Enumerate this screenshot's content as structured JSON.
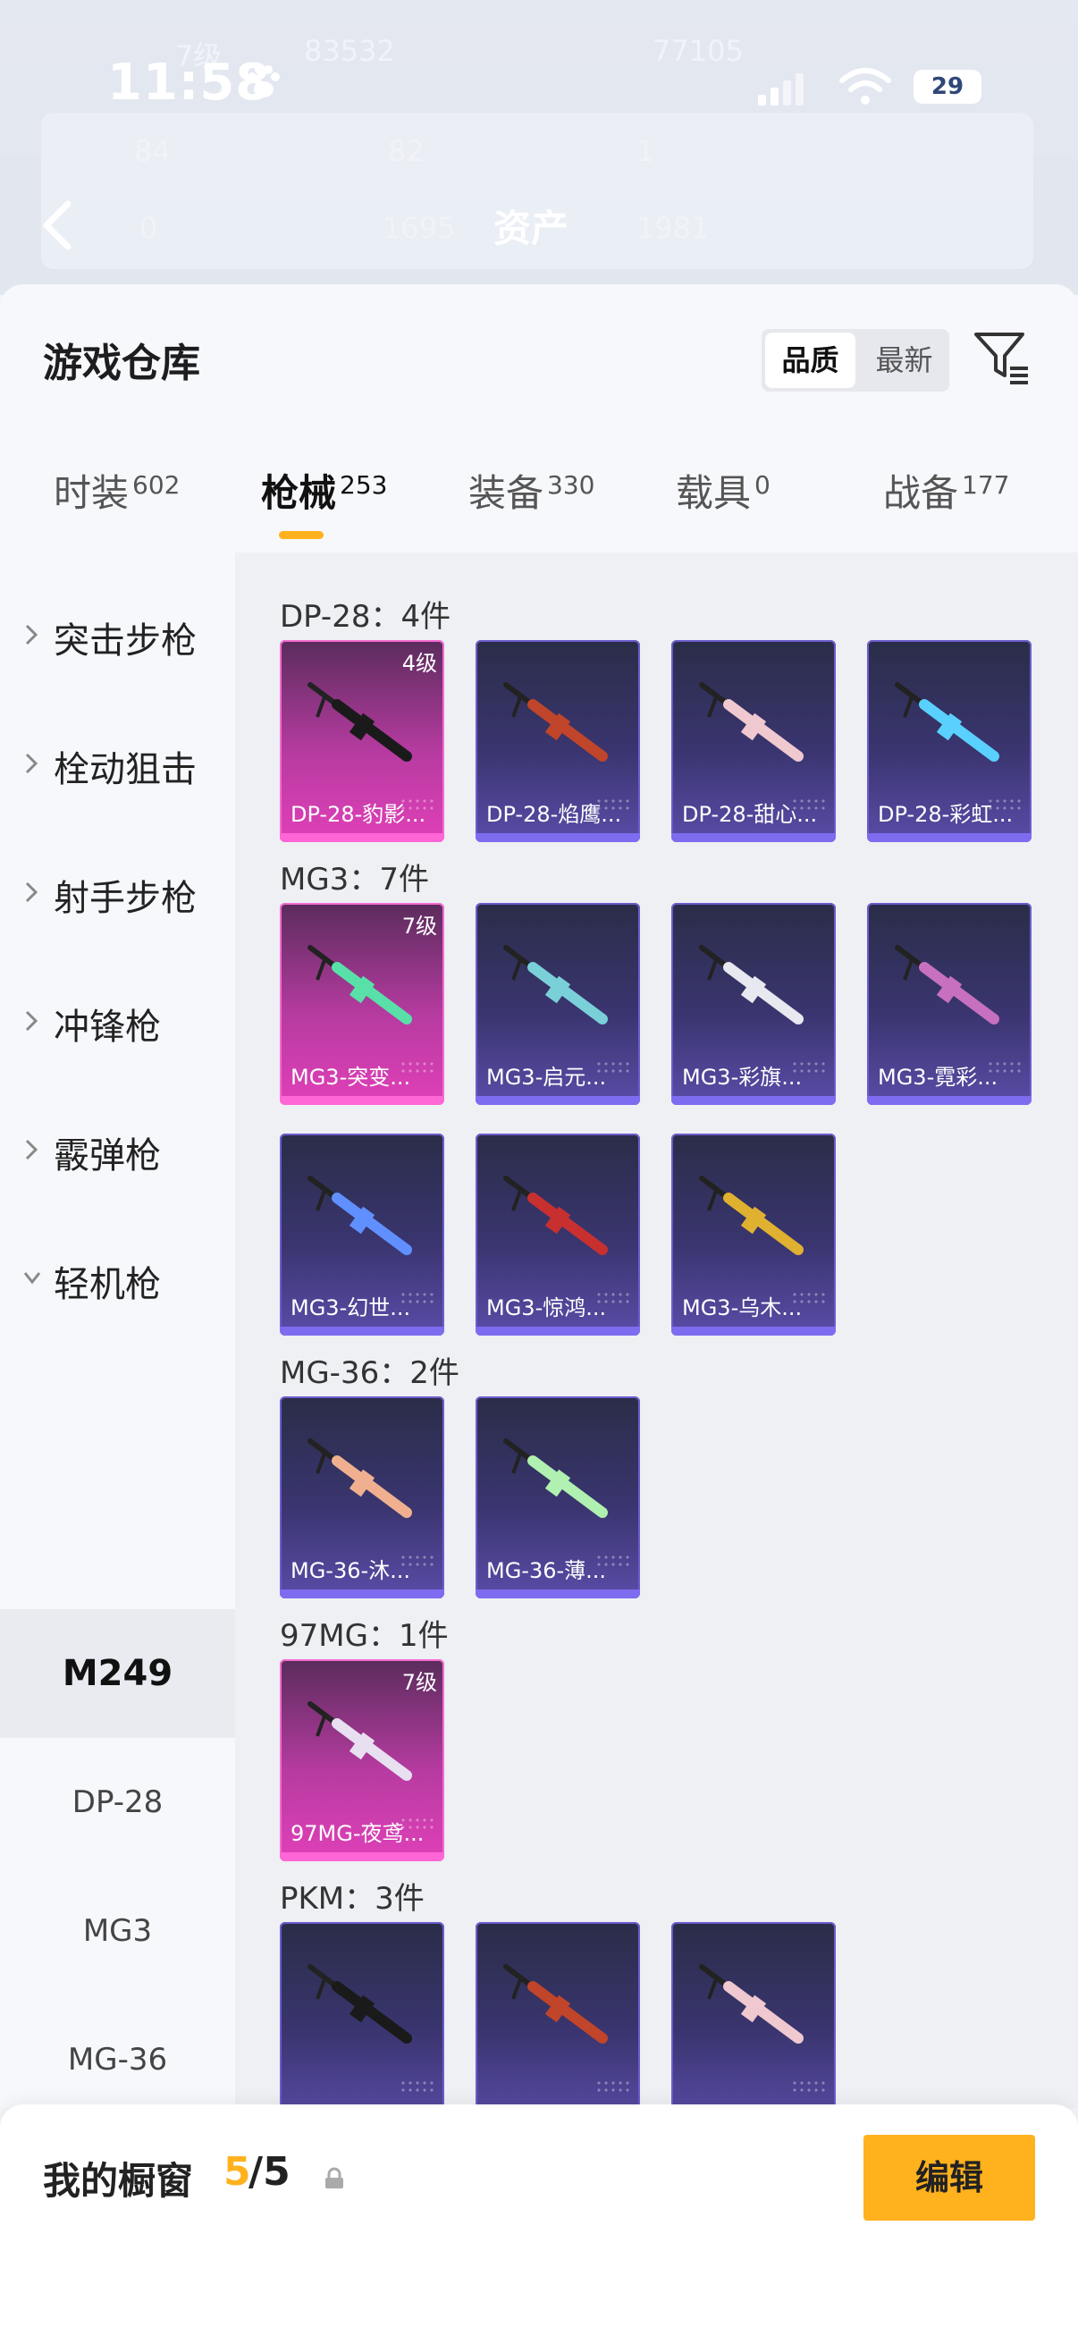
{
  "status_bar": {
    "time": "11:58",
    "battery": "29"
  },
  "background": {
    "title": "资产",
    "faded_texts": [
      "7级",
      "83532",
      "77105",
      "84",
      "82",
      "1",
      "0",
      "1695",
      "1981"
    ]
  },
  "header": {
    "title": "游戏仓库",
    "sort_options": [
      "品质",
      "最新"
    ]
  },
  "tabs": [
    {
      "label": "时装",
      "count": "602"
    },
    {
      "label": "枪械",
      "count": "253"
    },
    {
      "label": "装备",
      "count": "330"
    },
    {
      "label": "载具",
      "count": "0"
    },
    {
      "label": "战备",
      "count": "177"
    }
  ],
  "sidebar": {
    "categories": [
      "突击步枪",
      "栓动狙击",
      "射手步枪",
      "冲锋枪",
      "霰弹枪",
      "轻机枪"
    ],
    "subcategories": [
      "M249",
      "DP-28",
      "MG3",
      "MG-36",
      "97MG",
      "PKM"
    ]
  },
  "groups": [
    {
      "title": "DP-28：4件",
      "items": [
        {
          "name": "DP-28-豹影...",
          "level": "4级",
          "quality": "gold"
        },
        {
          "name": "DP-28-焰鹰...",
          "level": "",
          "quality": "purple"
        },
        {
          "name": "DP-28-甜心...",
          "level": "",
          "quality": "purple"
        },
        {
          "name": "DP-28-彩虹...",
          "level": "",
          "quality": "purple"
        }
      ]
    },
    {
      "title": "MG3：7件",
      "items": [
        {
          "name": "MG3-突变...",
          "level": "7级",
          "quality": "gold"
        },
        {
          "name": "MG3-启元...",
          "level": "",
          "quality": "purple"
        },
        {
          "name": "MG3-彩旗...",
          "level": "",
          "quality": "purple"
        },
        {
          "name": "MG3-霓彩...",
          "level": "",
          "quality": "purple"
        },
        {
          "name": "MG3-幻世...",
          "level": "",
          "quality": "purple"
        },
        {
          "name": "MG3-惊鸿...",
          "level": "",
          "quality": "purple"
        },
        {
          "name": "MG3-乌木...",
          "level": "",
          "quality": "purple"
        }
      ]
    },
    {
      "title": "MG-36：2件",
      "items": [
        {
          "name": "MG-36-沐...",
          "level": "",
          "quality": "purple"
        },
        {
          "name": "MG-36-薄...",
          "level": "",
          "quality": "purple"
        }
      ]
    },
    {
      "title": "97MG：1件",
      "items": [
        {
          "name": "97MG-夜鸢...",
          "level": "7级",
          "quality": "gold"
        }
      ]
    },
    {
      "title": "PKM：3件",
      "items": [
        {
          "name": "",
          "level": "",
          "quality": "purple"
        },
        {
          "name": "",
          "level": "",
          "quality": "purple"
        },
        {
          "name": "",
          "level": "",
          "quality": "purple"
        }
      ]
    }
  ],
  "showcase": {
    "label": "我的橱窗",
    "count": "5",
    "total": "/5",
    "edit_label": "编辑"
  },
  "colors": {
    "accent": "#ffb21e",
    "gold_card": "#e040b8",
    "purple_card": "#5a4ca8"
  }
}
